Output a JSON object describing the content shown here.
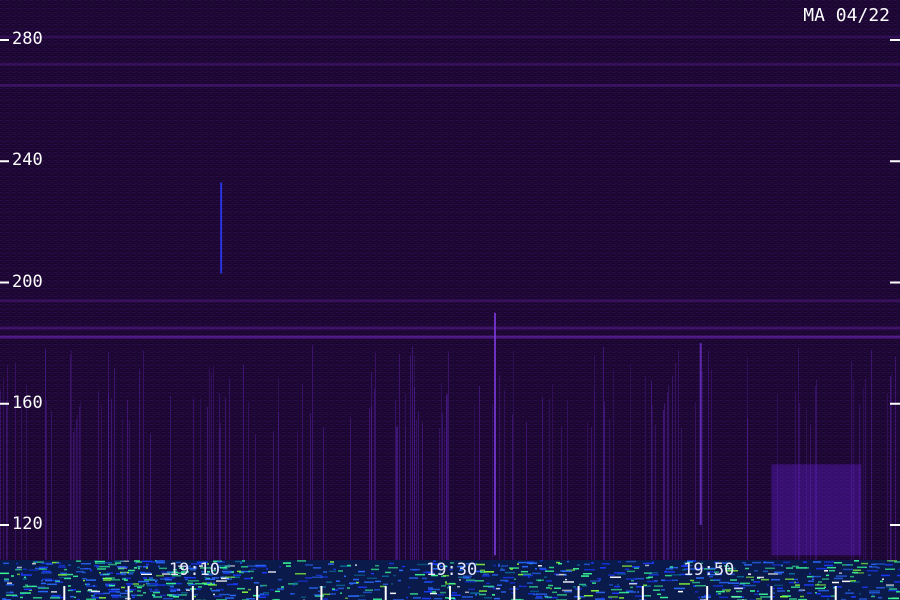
{
  "chart_data": {
    "type": "heatmap",
    "title": "",
    "station_date": "MA 04/22",
    "xlabel": "",
    "ylabel": "",
    "ylim": [
      100,
      290
    ],
    "y_ticks": [
      120,
      160,
      200,
      240,
      280
    ],
    "y_tick_labels": [
      "120",
      "160",
      "200",
      "240",
      "280"
    ],
    "x_tick_labels": [
      {
        "time": "19:10",
        "minutes": 10
      },
      {
        "time": "19:30",
        "minutes": 30
      },
      {
        "time": "19:50",
        "minutes": 50
      }
    ],
    "x_range_minutes": [
      -5,
      65
    ],
    "x_minor_tick_minutes": [
      0,
      5,
      10,
      15,
      20,
      25,
      30,
      35,
      40,
      45,
      50,
      55,
      60
    ],
    "horizontal_bands": [
      {
        "y": 182,
        "intensity": 0.55
      },
      {
        "y": 185,
        "intensity": 0.35
      },
      {
        "y": 194,
        "intensity": 0.25
      },
      {
        "y": 265,
        "intensity": 0.3
      },
      {
        "y": 272,
        "intensity": 0.25
      },
      {
        "y": 281,
        "intensity": 0.2
      }
    ],
    "vertical_features": [
      {
        "minutes": 12.2,
        "y_from": 203,
        "y_to": 233,
        "color": "#2a3cff"
      },
      {
        "minutes": 33.5,
        "y_from": 110,
        "y_to": 190,
        "color": "#7a3ad8"
      },
      {
        "minutes": 49.5,
        "y_from": 120,
        "y_to": 180,
        "color": "#6a30c8"
      }
    ],
    "hot_region": {
      "minutes_from": 55,
      "minutes_to": 62,
      "y_from": 110,
      "y_to": 140,
      "color": "#6a20e0"
    },
    "grid": false,
    "colors": {
      "background": "#1a0630",
      "band": "#7a2cc8",
      "low_band": "#2a6aff",
      "hot": "#3cff9a",
      "axis": "#ffffff"
    }
  }
}
